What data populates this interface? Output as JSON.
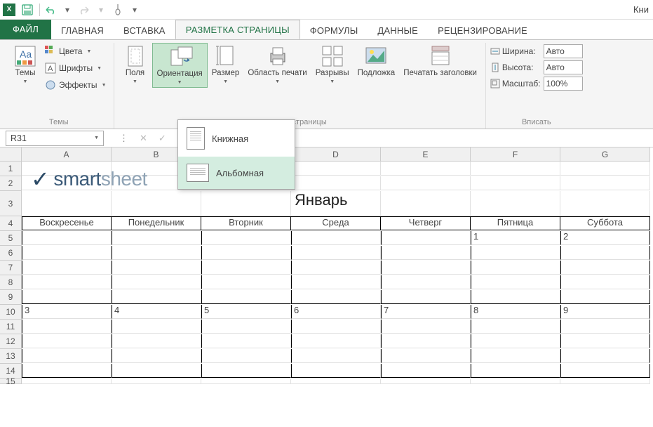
{
  "qat": {
    "title_fragment": "Кни"
  },
  "tabs": {
    "file": "ФАЙЛ",
    "items": [
      "ГЛАВНАЯ",
      "ВСТАВКА",
      "РАЗМЕТКА СТРАНИЦЫ",
      "ФОРМУЛЫ",
      "ДАННЫЕ",
      "РЕЦЕНЗИРОВАНИЕ"
    ],
    "active_index": 2
  },
  "ribbon": {
    "themes": {
      "main": "Темы",
      "colors": "Цвета",
      "fonts": "Шрифты",
      "effects": "Эффекты",
      "group": "Темы"
    },
    "page_setup": {
      "margins": "Поля",
      "orientation": "Ориентация",
      "size": "Размер",
      "print_area": "Область печати",
      "breaks": "Разрывы",
      "background": "Подложка",
      "print_titles": "Печатать заголовки",
      "group": "етры страницы"
    },
    "fit": {
      "width": "Ширина:",
      "height": "Высота:",
      "scale": "Масштаб:",
      "width_val": "Авто",
      "height_val": "Авто",
      "scale_val": "100%",
      "group": "Вписать"
    }
  },
  "orientation_menu": {
    "portrait": "Книжная",
    "landscape": "Альбомная"
  },
  "formula_bar": {
    "cell_ref": "R31"
  },
  "columns": [
    "A",
    "B",
    "C",
    "D",
    "E",
    "F",
    "G"
  ],
  "rows": [
    "1",
    "2",
    "3",
    "4",
    "5",
    "6",
    "7",
    "8",
    "9",
    "10",
    "11",
    "12",
    "13",
    "14",
    "15"
  ],
  "calendar": {
    "logo_text_1": "smart",
    "logo_text_2": "sheet",
    "month": "Январь",
    "headers": [
      "Воскресенье",
      "Понедельник",
      "Вторник",
      "Среда",
      "Четверг",
      "Пятница",
      "Суббота"
    ],
    "week1": [
      "",
      "",
      "",
      "",
      "",
      "1",
      "2"
    ],
    "week2": [
      "3",
      "4",
      "5",
      "6",
      "7",
      "8",
      "9"
    ]
  }
}
